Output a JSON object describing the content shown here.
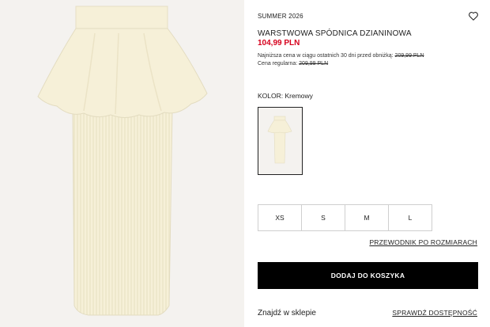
{
  "product": {
    "collection": "SUMMER 2026",
    "title": "WARSTWOWA SPÓDNICA DZIANINOWA",
    "price": "104,99 PLN",
    "lowest_price_label": "Najniższa cena w ciągu ostatnich 30 dni przed obniżką: ",
    "lowest_price_value": "209,99 PLN",
    "regular_price_label": "Cena regularna: ",
    "regular_price_value": "209,99 PLN",
    "color_label": "KOLOR: Kremowy"
  },
  "sizes": [
    "XS",
    "S",
    "M",
    "L"
  ],
  "actions": {
    "size_guide": "PRZEWODNIK PO ROZMIARACH",
    "add_to_cart": "DODAJ DO KOSZYKA",
    "find_in_store": "Znajdź w sklepie",
    "check_availability": "SPRAWDŹ DOSTĘPNOŚĆ"
  },
  "icons": {
    "wishlist": "heart-icon"
  },
  "colors": {
    "price": "#d6001c",
    "garment": "#f6f0d8",
    "button": "#000000"
  }
}
